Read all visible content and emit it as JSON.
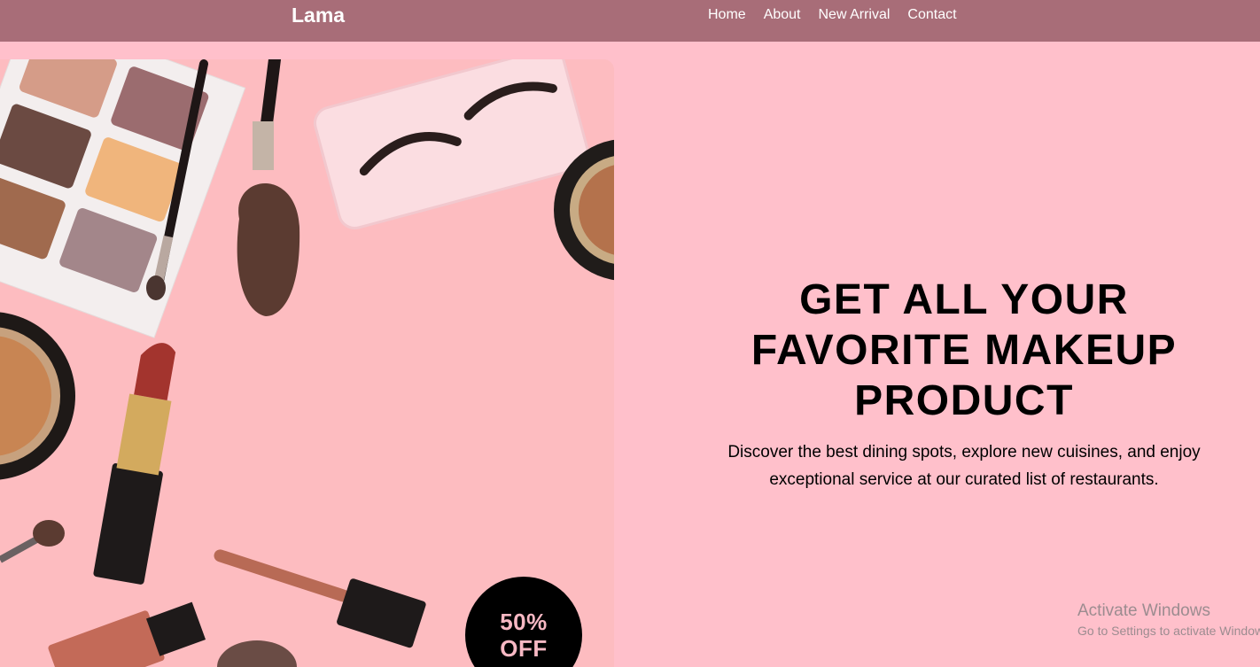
{
  "navbar": {
    "logo": "Lama",
    "links": [
      "Home",
      "About",
      "New Arrival",
      "Contact"
    ]
  },
  "hero": {
    "badge": "50%\nOFF",
    "title": "GET ALL YOUR\nFAVORITE MAKEUP\nPRODUCT",
    "description": "Discover the best dining spots, explore new cuisines, and enjoy exceptional service at our curated list of restaurants."
  },
  "system_watermark": {
    "title": "Activate Windows",
    "subtitle": "Go to Settings to activate Windows."
  },
  "colors": {
    "navbar_bg": "#a86d78",
    "page_bg": "#ffc0cb",
    "image_bg": "#fdbcc0",
    "badge_bg": "#000000",
    "badge_text": "#f7b8c3"
  }
}
